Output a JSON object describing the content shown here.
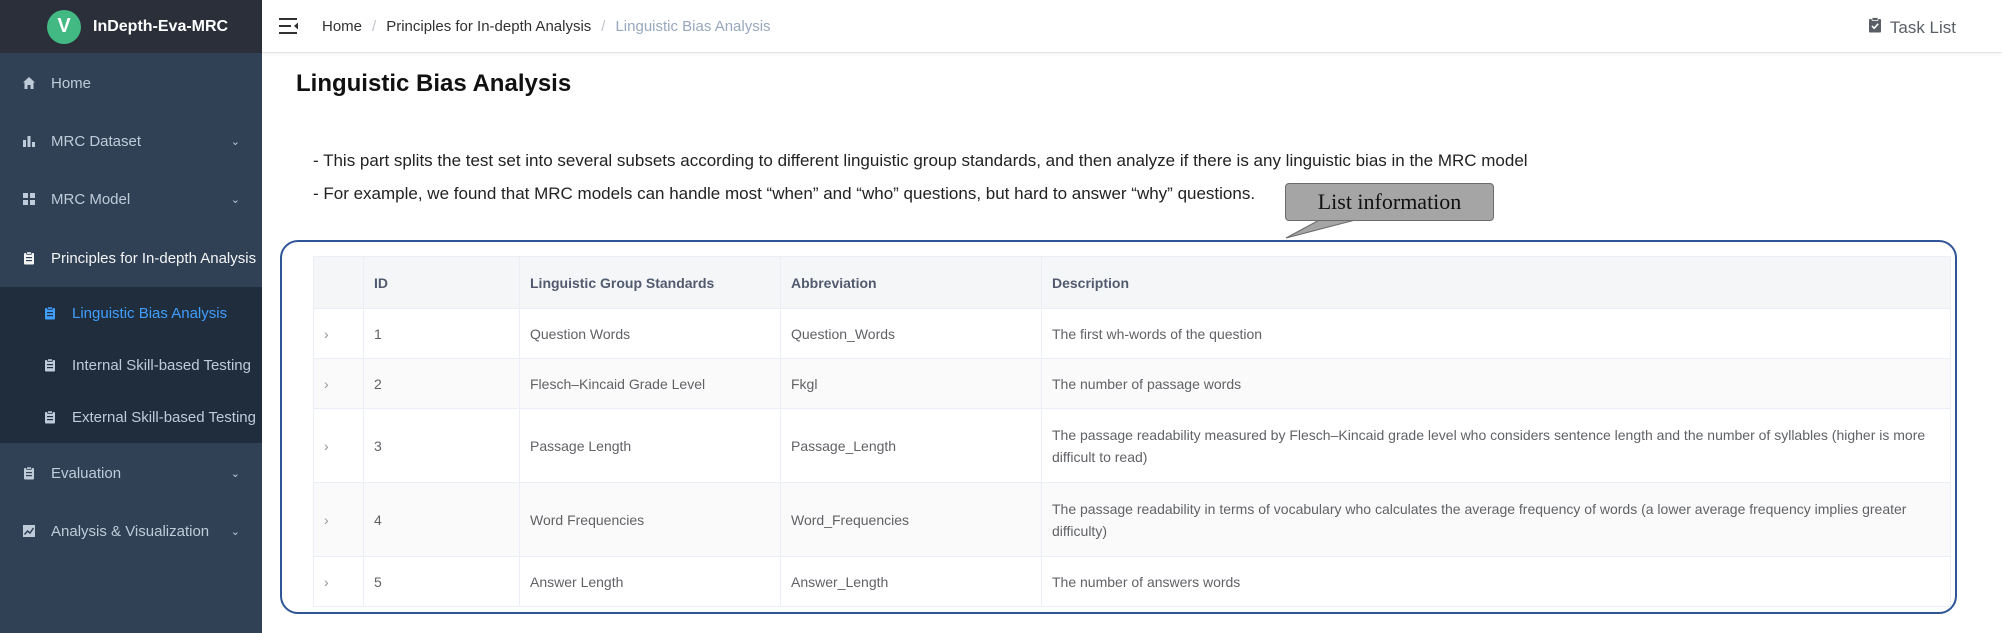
{
  "app": {
    "logo_letter": "V",
    "title": "InDepth-Eva-MRC"
  },
  "sidebar": {
    "items": [
      {
        "label": "Home",
        "icon": "home-icon"
      },
      {
        "label": "MRC Dataset",
        "icon": "bar-chart-icon"
      },
      {
        "label": "MRC Model",
        "icon": "grid-icon"
      },
      {
        "label": "Principles for In-depth Analysis",
        "icon": "clipboard-icon"
      },
      {
        "label": "Linguistic Bias Analysis",
        "icon": "clipboard-icon"
      },
      {
        "label": "Internal Skill-based Testing",
        "icon": "clipboard-icon"
      },
      {
        "label": "External Skill-based Testing",
        "icon": "clipboard-icon"
      },
      {
        "label": "Evaluation",
        "icon": "clipboard-icon"
      },
      {
        "label": "Analysis & Visualization",
        "icon": "line-chart-icon"
      }
    ]
  },
  "navbar": {
    "breadcrumb": [
      "Home",
      "Principles for In-depth Analysis",
      "Linguistic Bias Analysis"
    ],
    "task_list": "Task List"
  },
  "main": {
    "title": "Linguistic Bias Analysis",
    "intro": [
      "- This part splits the test set into several subsets according to different linguistic group standards, and then analyze if there is any linguistic bias in the MRC model",
      "- For example, we found that MRC models can handle most “when” and “who” questions, but hard to answer “why” questions."
    ],
    "callout": "List information"
  },
  "table": {
    "headers": [
      "ID",
      "Linguistic Group Standards",
      "Abbreviation",
      "Description"
    ],
    "rows": [
      {
        "id": "1",
        "standard": "Question Words",
        "abbr": "Question_Words",
        "desc": "The first wh-words of the question"
      },
      {
        "id": "2",
        "standard": "Flesch–Kincaid Grade Level",
        "abbr": "Fkgl",
        "desc": "The number of passage words"
      },
      {
        "id": "3",
        "standard": "Passage Length",
        "abbr": "Passage_Length",
        "desc": "The passage readability measured by Flesch–Kincaid grade level who considers sentence length and the number of syllables (higher is more difficult to read)"
      },
      {
        "id": "4",
        "standard": "Word Frequencies",
        "abbr": "Word_Frequencies",
        "desc": "The passage readability in terms of vocabulary who calculates the average frequency of words (a lower average frequency implies greater difficulty)"
      },
      {
        "id": "5",
        "standard": "Answer Length",
        "abbr": "Answer_Length",
        "desc": "The number of answers words"
      }
    ]
  }
}
